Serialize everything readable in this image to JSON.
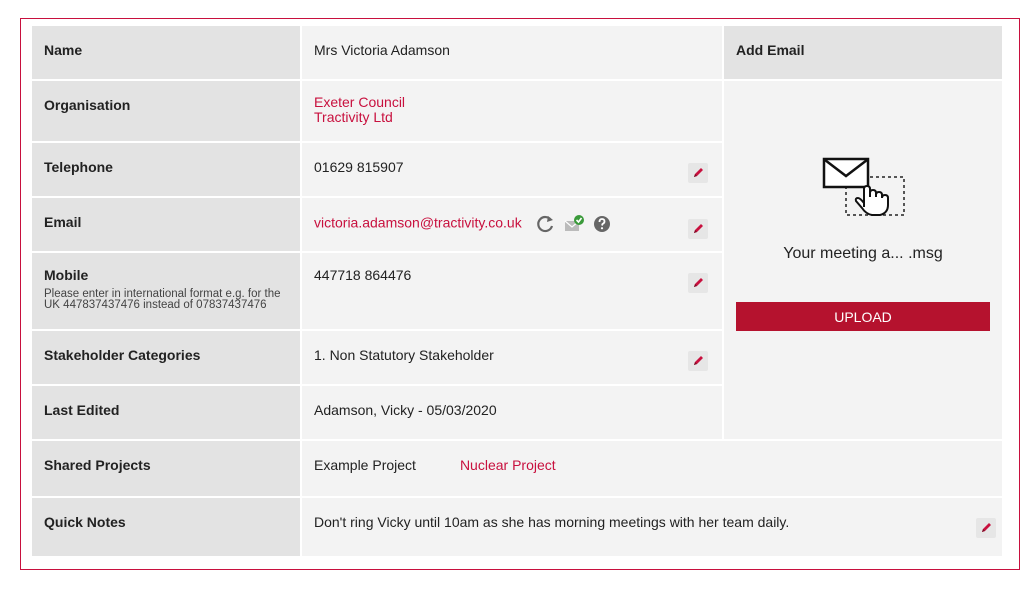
{
  "rows": {
    "name": {
      "label": "Name",
      "value": "Mrs Victoria Adamson"
    },
    "organisation": {
      "label": "Organisation",
      "values": [
        "Exeter Council",
        "Tractivity Ltd"
      ]
    },
    "telephone": {
      "label": "Telephone",
      "value": "01629 815907"
    },
    "email": {
      "label": "Email",
      "value": "victoria.adamson@tractivity.co.uk"
    },
    "mobile": {
      "label": "Mobile",
      "hint": "Please enter in international format e.g. for the UK 447837437476 instead of 07837437476",
      "value": "447718 864476"
    },
    "stakeholder_categories": {
      "label": "Stakeholder Categories",
      "value": "1. Non Statutory Stakeholder"
    },
    "last_edited": {
      "label": "Last Edited",
      "value": "Adamson, Vicky - 05/03/2020"
    },
    "shared_projects": {
      "label": "Shared Projects",
      "values": [
        "Example Project",
        "Nuclear Project"
      ]
    },
    "quick_notes": {
      "label": "Quick Notes",
      "value": "Don't ring Vicky until 10am as she has morning meetings with her team daily."
    }
  },
  "add_email": {
    "title": "Add Email",
    "file_name": "Your meeting a... .msg",
    "upload_label": "UPLOAD"
  },
  "colors": {
    "accent": "#c8103e",
    "upload_bg": "#b5122e",
    "label_bg": "#e3e3e3",
    "value_bg": "#f3f3f3"
  },
  "icons": [
    "pencil-icon",
    "refresh-icon",
    "email-verified-icon",
    "help-icon",
    "email-drop-icon"
  ]
}
